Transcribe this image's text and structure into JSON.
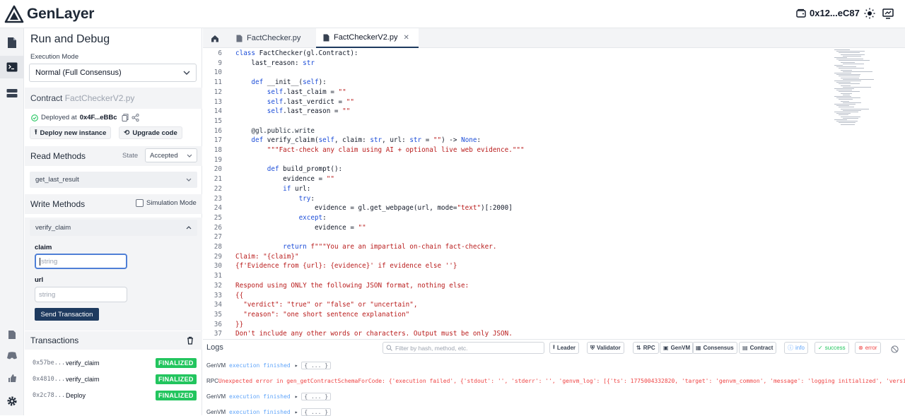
{
  "app": {
    "name": "GenLayer",
    "wallet_address": "0x12...eC87"
  },
  "sidebar": {
    "title": "Run and Debug",
    "execution_mode_label": "Execution Mode",
    "execution_mode_value": "Normal (Full Consensus)",
    "contract_label": "Contract",
    "contract_file": "FactCheckerV2.py",
    "deployed_label": "Deployed at",
    "deployed_address": "0x4F...eBBc",
    "deploy_new_label": "Deploy new instance",
    "upgrade_label": "Upgrade code",
    "read_methods_label": "Read Methods",
    "state_label": "State",
    "state_value": "Accepted",
    "read_method": "get_last_result",
    "write_methods_label": "Write Methods",
    "simulation_mode_label": "Simulation Mode",
    "write_method": "verify_claim",
    "claim_label": "claim",
    "claim_placeholder": "string",
    "url_label": "url",
    "url_placeholder": "string",
    "send_label": "Send Transaction",
    "transactions_label": "Transactions",
    "transactions": [
      {
        "hash": "0x57be...",
        "method": "verify_claim",
        "status": "FINALIZED"
      },
      {
        "hash": "0x4810...",
        "method": "verify_claim",
        "status": "FINALIZED"
      },
      {
        "hash": "0x2c78...",
        "method": "Deploy",
        "status": "FINALIZED"
      }
    ]
  },
  "tabs": [
    {
      "label": "FactChecker.py"
    },
    {
      "label": "FactCheckerV2.py"
    }
  ],
  "code_lines": [
    {
      "n": "6",
      "t": "class FactChecker(gl.Contract):"
    },
    {
      "n": "9",
      "t": "    last_reason: str"
    },
    {
      "n": "10",
      "t": ""
    },
    {
      "n": "11",
      "t": "    def __init__(self):"
    },
    {
      "n": "12",
      "t": "        self.last_claim = \"\""
    },
    {
      "n": "13",
      "t": "        self.last_verdict = \"\""
    },
    {
      "n": "14",
      "t": "        self.last_reason = \"\""
    },
    {
      "n": "15",
      "t": ""
    },
    {
      "n": "16",
      "t": "    @gl.public.write"
    },
    {
      "n": "17",
      "t": "    def verify_claim(self, claim: str, url: str = \"\") -> None:"
    },
    {
      "n": "18",
      "t": "        \"\"\"Fact-check any claim using AI + optional live web evidence.\"\"\""
    },
    {
      "n": "19",
      "t": ""
    },
    {
      "n": "20",
      "t": "        def build_prompt():"
    },
    {
      "n": "21",
      "t": "            evidence = \"\""
    },
    {
      "n": "22",
      "t": "            if url:"
    },
    {
      "n": "23",
      "t": "                try:"
    },
    {
      "n": "24",
      "t": "                    evidence = gl.get_webpage(url, mode=\"text\")[:2000]"
    },
    {
      "n": "25",
      "t": "                except:"
    },
    {
      "n": "26",
      "t": "                    evidence = \"\""
    },
    {
      "n": "27",
      "t": ""
    },
    {
      "n": "28",
      "t": "            return f\"\"\"You are an impartial on-chain fact-checker."
    },
    {
      "n": "29",
      "t": "Claim: \"{claim}\""
    },
    {
      "n": "30",
      "t": "{f'Evidence from {url}: {evidence}' if evidence else ''}"
    },
    {
      "n": "31",
      "t": ""
    },
    {
      "n": "32",
      "t": "Respond using ONLY the following JSON format, nothing else:"
    },
    {
      "n": "33",
      "t": "{{"
    },
    {
      "n": "34",
      "t": "  \"verdict\": \"true\" or \"false\" or \"uncertain\","
    },
    {
      "n": "35",
      "t": "  \"reason\": \"one short sentence explanation\""
    },
    {
      "n": "36",
      "t": "}}"
    },
    {
      "n": "37",
      "t": "Don't include any other words or characters. Output must be only JSON."
    }
  ],
  "logs": {
    "title": "Logs",
    "search_placeholder": "Filter by hash, method, etc.",
    "filters": [
      "Leader",
      "Validator",
      "RPC",
      "GenVM",
      "Consensus",
      "Contract"
    ],
    "levels": [
      "info",
      "success",
      "error"
    ],
    "entries": [
      {
        "src": "GenVM",
        "msg": "execution finished",
        "obj": "{ ... }",
        "err": false
      },
      {
        "src": "RPC",
        "msg": "Unexpected error in gen_getContractSchemaForCode: {'execution failed', {'stdout': '', 'stderr': '', 'genvm_log': [{'ts': 1775004332820, 'target': 'genvm_common', 'message': 'logging initialized', 'version': '",
        "obj": "",
        "err": true
      },
      {
        "src": "GenVM",
        "msg": "execution finished",
        "obj": "{ ... }",
        "err": false
      },
      {
        "src": "GenVM",
        "msg": "execution finished",
        "obj": "{ ... }",
        "err": false
      }
    ]
  },
  "colors": {
    "accent": "#1e3a5f",
    "finalized": "#22c55e",
    "keyword": "#1d4ed8",
    "string": "#b91c1c"
  }
}
